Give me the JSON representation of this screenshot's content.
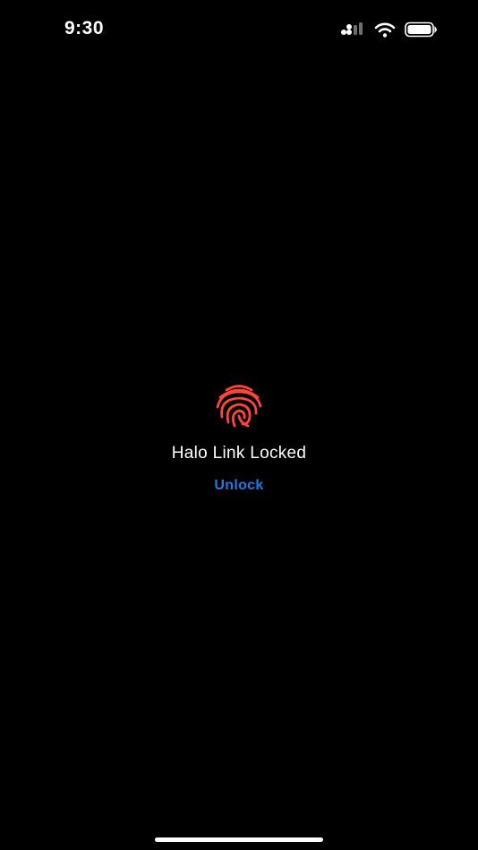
{
  "status_bar": {
    "time": "9:30",
    "icons": [
      "cellular-signal-icon",
      "wifi-icon",
      "battery-icon"
    ]
  },
  "lock_screen": {
    "icon": "fingerprint-icon",
    "title": "Halo Link Locked",
    "unlock_label": "Unlock"
  },
  "colors": {
    "background": "#000000",
    "fingerprint": "#ff453a",
    "accent": "#1f7ae6",
    "text": "#ffffff"
  }
}
